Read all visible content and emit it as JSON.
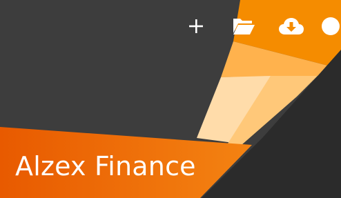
{
  "app": {
    "title": "Alzex Finance"
  },
  "toolbar": {
    "buttons": [
      {
        "icon": "plus-icon"
      },
      {
        "icon": "folder-open-icon"
      },
      {
        "icon": "cloud-download-icon"
      },
      {
        "icon": "circle-menu-icon"
      }
    ]
  },
  "colors": {
    "background": "#3d3d3d",
    "dark_panel": "#2b2b2b",
    "orange": "#f58c00",
    "orange_light": "#ffb24d",
    "orange_pale": "#ffc879",
    "peach": "#ffdcaa",
    "banner_start": "#e85a00",
    "banner_end": "#f48312"
  }
}
